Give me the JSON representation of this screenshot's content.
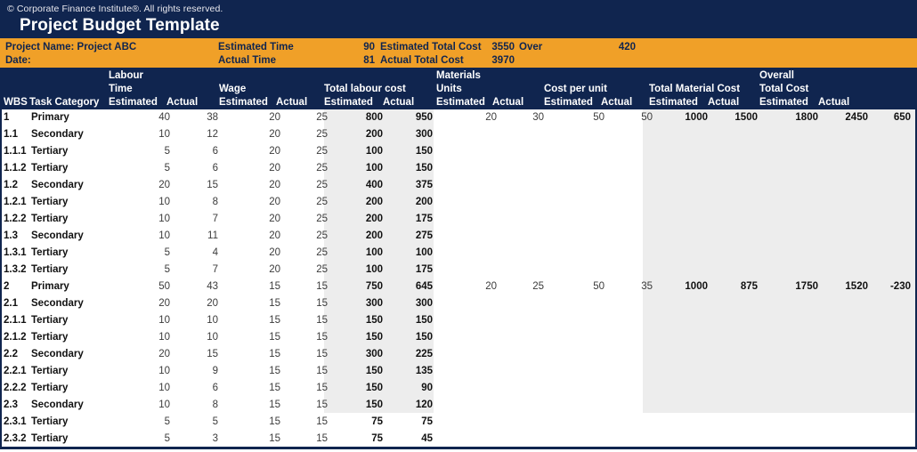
{
  "banner": {
    "copyright": "© Corporate Finance Institute®. All rights reserved.",
    "title": "Project Budget Template"
  },
  "summary": {
    "project_name": "Project Name: Project ABC",
    "date_label": "Date:",
    "estimated_time_label": "Estimated Time",
    "estimated_time_value": "90",
    "actual_time_label": "Actual Time",
    "actual_time_value": "81",
    "estimated_total_cost_label": "Estimated Total Cost",
    "estimated_total_cost_value": "3550",
    "actual_total_cost_label": "Actual Total Cost",
    "actual_total_cost_value": "3970",
    "over_label": "Over",
    "over_value": "420"
  },
  "headers": {
    "wbs": "WBS",
    "task_category": "Task Category",
    "labour": "Labour",
    "time": "Time",
    "time_estimated": "Estimated",
    "time_actual": "Actual",
    "wage": "Wage",
    "wage_estimated": "Estimated",
    "wage_actual": "Actual",
    "total_labour_cost": "Total labour cost",
    "tlc_estimated": "Estimated",
    "tlc_actual": "Actual",
    "materials": "Materials",
    "units": "Units",
    "units_estimated": "Estimated",
    "units_actual": "Actual",
    "cost_per_unit": "Cost per unit",
    "cpu_estimated": "Estimated",
    "cpu_actual": "Actual",
    "total_material_cost": "Total Material Cost",
    "tmc_estimated": "Estimated",
    "tmc_actual": "Actual",
    "overall": "Overall",
    "total_cost": "Total Cost",
    "oc_estimated": "Estimated",
    "oc_actual": "Actual"
  },
  "colors": {
    "navy": "#10254f",
    "orange": "#f0a028",
    "shade": "#ededed"
  },
  "rows": [
    {
      "wbs": "1",
      "category": "Primary",
      "time_est": "40",
      "time_act": "38",
      "wage_est": "20",
      "wage_act": "25",
      "tlc_est": "800",
      "tlc_act": "950",
      "units_est": "20",
      "units_act": "30",
      "cpu_est": "50",
      "cpu_act": "50",
      "tmc_est": "1000",
      "tmc_act": "1500",
      "oc_est": "1800",
      "oc_act": "2450",
      "variance": "650"
    },
    {
      "wbs": "1.1",
      "category": "Secondary",
      "time_est": "10",
      "time_act": "12",
      "wage_est": "20",
      "wage_act": "25",
      "tlc_est": "200",
      "tlc_act": "300",
      "units_est": "",
      "units_act": "",
      "cpu_est": "",
      "cpu_act": "",
      "tmc_est": "",
      "tmc_act": "",
      "oc_est": "",
      "oc_act": "",
      "variance": ""
    },
    {
      "wbs": "1.1.1",
      "category": "Tertiary",
      "time_est": "5",
      "time_act": "6",
      "wage_est": "20",
      "wage_act": "25",
      "tlc_est": "100",
      "tlc_act": "150",
      "units_est": "",
      "units_act": "",
      "cpu_est": "",
      "cpu_act": "",
      "tmc_est": "",
      "tmc_act": "",
      "oc_est": "",
      "oc_act": "",
      "variance": ""
    },
    {
      "wbs": "1.1.2",
      "category": "Tertiary",
      "time_est": "5",
      "time_act": "6",
      "wage_est": "20",
      "wage_act": "25",
      "tlc_est": "100",
      "tlc_act": "150",
      "units_est": "",
      "units_act": "",
      "cpu_est": "",
      "cpu_act": "",
      "tmc_est": "",
      "tmc_act": "",
      "oc_est": "",
      "oc_act": "",
      "variance": ""
    },
    {
      "wbs": "1.2",
      "category": "Secondary",
      "time_est": "20",
      "time_act": "15",
      "wage_est": "20",
      "wage_act": "25",
      "tlc_est": "400",
      "tlc_act": "375",
      "units_est": "",
      "units_act": "",
      "cpu_est": "",
      "cpu_act": "",
      "tmc_est": "",
      "tmc_act": "",
      "oc_est": "",
      "oc_act": "",
      "variance": ""
    },
    {
      "wbs": "1.2.1",
      "category": "Tertiary",
      "time_est": "10",
      "time_act": "8",
      "wage_est": "20",
      "wage_act": "25",
      "tlc_est": "200",
      "tlc_act": "200",
      "units_est": "",
      "units_act": "",
      "cpu_est": "",
      "cpu_act": "",
      "tmc_est": "",
      "tmc_act": "",
      "oc_est": "",
      "oc_act": "",
      "variance": ""
    },
    {
      "wbs": "1.2.2",
      "category": "Tertiary",
      "time_est": "10",
      "time_act": "7",
      "wage_est": "20",
      "wage_act": "25",
      "tlc_est": "200",
      "tlc_act": "175",
      "units_est": "",
      "units_act": "",
      "cpu_est": "",
      "cpu_act": "",
      "tmc_est": "",
      "tmc_act": "",
      "oc_est": "",
      "oc_act": "",
      "variance": ""
    },
    {
      "wbs": "1.3",
      "category": "Secondary",
      "time_est": "10",
      "time_act": "11",
      "wage_est": "20",
      "wage_act": "25",
      "tlc_est": "200",
      "tlc_act": "275",
      "units_est": "",
      "units_act": "",
      "cpu_est": "",
      "cpu_act": "",
      "tmc_est": "",
      "tmc_act": "",
      "oc_est": "",
      "oc_act": "",
      "variance": ""
    },
    {
      "wbs": "1.3.1",
      "category": "Tertiary",
      "time_est": "5",
      "time_act": "4",
      "wage_est": "20",
      "wage_act": "25",
      "tlc_est": "100",
      "tlc_act": "100",
      "units_est": "",
      "units_act": "",
      "cpu_est": "",
      "cpu_act": "",
      "tmc_est": "",
      "tmc_act": "",
      "oc_est": "",
      "oc_act": "",
      "variance": ""
    },
    {
      "wbs": "1.3.2",
      "category": "Tertiary",
      "time_est": "5",
      "time_act": "7",
      "wage_est": "20",
      "wage_act": "25",
      "tlc_est": "100",
      "tlc_act": "175",
      "units_est": "",
      "units_act": "",
      "cpu_est": "",
      "cpu_act": "",
      "tmc_est": "",
      "tmc_act": "",
      "oc_est": "",
      "oc_act": "",
      "variance": ""
    },
    {
      "wbs": "2",
      "category": "Primary",
      "time_est": "50",
      "time_act": "43",
      "wage_est": "15",
      "wage_act": "15",
      "tlc_est": "750",
      "tlc_act": "645",
      "units_est": "20",
      "units_act": "25",
      "cpu_est": "50",
      "cpu_act": "35",
      "tmc_est": "1000",
      "tmc_act": "875",
      "oc_est": "1750",
      "oc_act": "1520",
      "variance": "-230"
    },
    {
      "wbs": "2.1",
      "category": "Secondary",
      "time_est": "20",
      "time_act": "20",
      "wage_est": "15",
      "wage_act": "15",
      "tlc_est": "300",
      "tlc_act": "300",
      "units_est": "",
      "units_act": "",
      "cpu_est": "",
      "cpu_act": "",
      "tmc_est": "",
      "tmc_act": "",
      "oc_est": "",
      "oc_act": "",
      "variance": ""
    },
    {
      "wbs": "2.1.1",
      "category": "Tertiary",
      "time_est": "10",
      "time_act": "10",
      "wage_est": "15",
      "wage_act": "15",
      "tlc_est": "150",
      "tlc_act": "150",
      "units_est": "",
      "units_act": "",
      "cpu_est": "",
      "cpu_act": "",
      "tmc_est": "",
      "tmc_act": "",
      "oc_est": "",
      "oc_act": "",
      "variance": ""
    },
    {
      "wbs": "2.1.2",
      "category": "Tertiary",
      "time_est": "10",
      "time_act": "10",
      "wage_est": "15",
      "wage_act": "15",
      "tlc_est": "150",
      "tlc_act": "150",
      "units_est": "",
      "units_act": "",
      "cpu_est": "",
      "cpu_act": "",
      "tmc_est": "",
      "tmc_act": "",
      "oc_est": "",
      "oc_act": "",
      "variance": ""
    },
    {
      "wbs": "2.2",
      "category": "Secondary",
      "time_est": "20",
      "time_act": "15",
      "wage_est": "15",
      "wage_act": "15",
      "tlc_est": "300",
      "tlc_act": "225",
      "units_est": "",
      "units_act": "",
      "cpu_est": "",
      "cpu_act": "",
      "tmc_est": "",
      "tmc_act": "",
      "oc_est": "",
      "oc_act": "",
      "variance": ""
    },
    {
      "wbs": "2.2.1",
      "category": "Tertiary",
      "time_est": "10",
      "time_act": "9",
      "wage_est": "15",
      "wage_act": "15",
      "tlc_est": "150",
      "tlc_act": "135",
      "units_est": "",
      "units_act": "",
      "cpu_est": "",
      "cpu_act": "",
      "tmc_est": "",
      "tmc_act": "",
      "oc_est": "",
      "oc_act": "",
      "variance": ""
    },
    {
      "wbs": "2.2.2",
      "category": "Tertiary",
      "time_est": "10",
      "time_act": "6",
      "wage_est": "15",
      "wage_act": "15",
      "tlc_est": "150",
      "tlc_act": "90",
      "units_est": "",
      "units_act": "",
      "cpu_est": "",
      "cpu_act": "",
      "tmc_est": "",
      "tmc_act": "",
      "oc_est": "",
      "oc_act": "",
      "variance": ""
    },
    {
      "wbs": "2.3",
      "category": "Secondary",
      "time_est": "10",
      "time_act": "8",
      "wage_est": "15",
      "wage_act": "15",
      "tlc_est": "150",
      "tlc_act": "120",
      "units_est": "",
      "units_act": "",
      "cpu_est": "",
      "cpu_act": "",
      "tmc_est": "",
      "tmc_act": "",
      "oc_est": "",
      "oc_act": "",
      "variance": ""
    },
    {
      "wbs": "2.3.1",
      "category": "Tertiary",
      "time_est": "5",
      "time_act": "5",
      "wage_est": "15",
      "wage_act": "15",
      "tlc_est": "75",
      "tlc_act": "75",
      "units_est": "",
      "units_act": "",
      "cpu_est": "",
      "cpu_act": "",
      "tmc_est": "",
      "tmc_act": "",
      "oc_est": "",
      "oc_act": "",
      "variance": ""
    },
    {
      "wbs": "2.3.2",
      "category": "Tertiary",
      "time_est": "5",
      "time_act": "3",
      "wage_est": "15",
      "wage_act": "15",
      "tlc_est": "75",
      "tlc_act": "45",
      "units_est": "",
      "units_act": "",
      "cpu_est": "",
      "cpu_act": "",
      "tmc_est": "",
      "tmc_act": "",
      "oc_est": "",
      "oc_act": "",
      "variance": ""
    }
  ]
}
